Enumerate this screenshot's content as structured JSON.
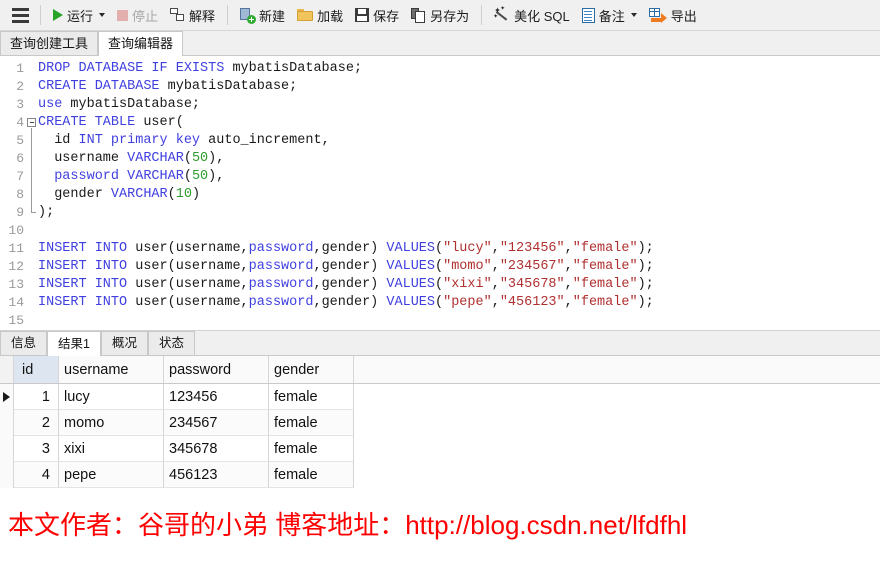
{
  "toolbar": {
    "menu_icon": "hamburger-icon",
    "items": [
      {
        "id": "run",
        "label": "运行",
        "icon": "play-triangle-icon",
        "has_caret": true,
        "disabled": false
      },
      {
        "id": "stop",
        "label": "停止",
        "icon": "stop-square-icon",
        "has_caret": false,
        "disabled": true
      },
      {
        "id": "explain",
        "label": "解释",
        "icon": "explain-icon",
        "has_caret": false,
        "disabled": false
      },
      {
        "id": "new",
        "label": "新建",
        "icon": "new-document-icon",
        "has_caret": false,
        "disabled": false
      },
      {
        "id": "load",
        "label": "加载",
        "icon": "folder-open-icon",
        "has_caret": false,
        "disabled": false
      },
      {
        "id": "save",
        "label": "保存",
        "icon": "floppy-save-icon",
        "has_caret": false,
        "disabled": false
      },
      {
        "id": "saveas",
        "label": "另存为",
        "icon": "save-as-icon",
        "has_caret": false,
        "disabled": false
      },
      {
        "id": "beautify",
        "label": "美化 SQL",
        "icon": "magic-wand-icon",
        "has_caret": false,
        "disabled": false
      },
      {
        "id": "comment",
        "label": "备注",
        "icon": "comment-doc-icon",
        "has_caret": true,
        "disabled": false
      },
      {
        "id": "export",
        "label": "导出",
        "icon": "export-arrow-icon",
        "has_caret": false,
        "disabled": false
      }
    ]
  },
  "editor_tabs": {
    "items": [
      {
        "label": "查询创建工具",
        "active": false
      },
      {
        "label": "查询编辑器",
        "active": true
      }
    ]
  },
  "editor": {
    "lines": [
      {
        "n": "1",
        "fold": "none",
        "tokens": [
          {
            "t": "DROP DATABASE IF EXISTS",
            "c": "kw"
          },
          {
            "t": " mybatisDatabase;",
            "c": ""
          }
        ]
      },
      {
        "n": "2",
        "fold": "none",
        "tokens": [
          {
            "t": "CREATE DATABASE",
            "c": "kw"
          },
          {
            "t": " mybatisDatabase;",
            "c": ""
          }
        ]
      },
      {
        "n": "3",
        "fold": "none",
        "tokens": [
          {
            "t": "use",
            "c": "kw"
          },
          {
            "t": " mybatisDatabase;",
            "c": ""
          }
        ]
      },
      {
        "n": "4",
        "fold": "start",
        "tokens": [
          {
            "t": "CREATE TABLE",
            "c": "kw"
          },
          {
            "t": " ",
            "c": ""
          },
          {
            "t": "user",
            "c": ""
          },
          {
            "t": "(",
            "c": ""
          }
        ]
      },
      {
        "n": "5",
        "fold": "line",
        "tokens": [
          {
            "t": "  id ",
            "c": ""
          },
          {
            "t": "INT primary key",
            "c": "kw"
          },
          {
            "t": " auto_increment,",
            "c": ""
          }
        ]
      },
      {
        "n": "6",
        "fold": "line",
        "tokens": [
          {
            "t": "  username ",
            "c": ""
          },
          {
            "t": "VARCHAR",
            "c": "kw"
          },
          {
            "t": "(",
            "c": ""
          },
          {
            "t": "50",
            "c": "num"
          },
          {
            "t": "),",
            "c": ""
          }
        ]
      },
      {
        "n": "7",
        "fold": "line",
        "tokens": [
          {
            "t": "  ",
            "c": ""
          },
          {
            "t": "password VARCHAR",
            "c": "kw"
          },
          {
            "t": "(",
            "c": ""
          },
          {
            "t": "50",
            "c": "num"
          },
          {
            "t": "),",
            "c": ""
          }
        ]
      },
      {
        "n": "8",
        "fold": "line",
        "tokens": [
          {
            "t": "  gender ",
            "c": ""
          },
          {
            "t": "VARCHAR",
            "c": "kw"
          },
          {
            "t": "(",
            "c": ""
          },
          {
            "t": "10",
            "c": "num"
          },
          {
            "t": ")",
            "c": ""
          }
        ]
      },
      {
        "n": "9",
        "fold": "end",
        "tokens": [
          {
            "t": ");",
            "c": ""
          }
        ]
      },
      {
        "n": "10",
        "fold": "none",
        "tokens": [
          {
            "t": "",
            "c": ""
          }
        ]
      },
      {
        "n": "11",
        "fold": "none",
        "tokens": [
          {
            "t": "INSERT INTO",
            "c": "kw"
          },
          {
            "t": " user(username,",
            "c": ""
          },
          {
            "t": "password",
            "c": "kw"
          },
          {
            "t": ",gender) ",
            "c": ""
          },
          {
            "t": "VALUES",
            "c": "kw"
          },
          {
            "t": "(",
            "c": ""
          },
          {
            "t": "\"lucy\"",
            "c": "str"
          },
          {
            "t": ",",
            "c": ""
          },
          {
            "t": "\"123456\"",
            "c": "str"
          },
          {
            "t": ",",
            "c": ""
          },
          {
            "t": "\"female\"",
            "c": "str"
          },
          {
            "t": ");",
            "c": ""
          }
        ]
      },
      {
        "n": "12",
        "fold": "none",
        "tokens": [
          {
            "t": "INSERT INTO",
            "c": "kw"
          },
          {
            "t": " user(username,",
            "c": ""
          },
          {
            "t": "password",
            "c": "kw"
          },
          {
            "t": ",gender) ",
            "c": ""
          },
          {
            "t": "VALUES",
            "c": "kw"
          },
          {
            "t": "(",
            "c": ""
          },
          {
            "t": "\"momo\"",
            "c": "str"
          },
          {
            "t": ",",
            "c": ""
          },
          {
            "t": "\"234567\"",
            "c": "str"
          },
          {
            "t": ",",
            "c": ""
          },
          {
            "t": "\"female\"",
            "c": "str"
          },
          {
            "t": ");",
            "c": ""
          }
        ]
      },
      {
        "n": "13",
        "fold": "none",
        "tokens": [
          {
            "t": "INSERT INTO",
            "c": "kw"
          },
          {
            "t": " user(username,",
            "c": ""
          },
          {
            "t": "password",
            "c": "kw"
          },
          {
            "t": ",gender) ",
            "c": ""
          },
          {
            "t": "VALUES",
            "c": "kw"
          },
          {
            "t": "(",
            "c": ""
          },
          {
            "t": "\"xixi\"",
            "c": "str"
          },
          {
            "t": ",",
            "c": ""
          },
          {
            "t": "\"345678\"",
            "c": "str"
          },
          {
            "t": ",",
            "c": ""
          },
          {
            "t": "\"female\"",
            "c": "str"
          },
          {
            "t": ");",
            "c": ""
          }
        ]
      },
      {
        "n": "14",
        "fold": "none",
        "tokens": [
          {
            "t": "INSERT INTO",
            "c": "kw"
          },
          {
            "t": " user(username,",
            "c": ""
          },
          {
            "t": "password",
            "c": "kw"
          },
          {
            "t": ",gender) ",
            "c": ""
          },
          {
            "t": "VALUES",
            "c": "kw"
          },
          {
            "t": "(",
            "c": ""
          },
          {
            "t": "\"pepe\"",
            "c": "str"
          },
          {
            "t": ",",
            "c": ""
          },
          {
            "t": "\"456123\"",
            "c": "str"
          },
          {
            "t": ",",
            "c": ""
          },
          {
            "t": "\"female\"",
            "c": "str"
          },
          {
            "t": ");",
            "c": ""
          }
        ]
      },
      {
        "n": "15",
        "fold": "none",
        "tokens": [
          {
            "t": "",
            "c": ""
          }
        ]
      }
    ]
  },
  "result_tabs": {
    "items": [
      {
        "label": "信息",
        "active": false
      },
      {
        "label": "结果1",
        "active": true
      },
      {
        "label": "概况",
        "active": false
      },
      {
        "label": "状态",
        "active": false
      }
    ]
  },
  "result_grid": {
    "columns": [
      "id",
      "username",
      "password",
      "gender"
    ],
    "selected_column": "id",
    "current_row_index": 0,
    "rows": [
      {
        "id": "1",
        "username": "lucy",
        "password": "123456",
        "gender": "female"
      },
      {
        "id": "2",
        "username": "momo",
        "password": "234567",
        "gender": "female"
      },
      {
        "id": "3",
        "username": "xixi",
        "password": "345678",
        "gender": "female"
      },
      {
        "id": "4",
        "username": "pepe",
        "password": "456123",
        "gender": "female"
      }
    ]
  },
  "watermark": {
    "text": "本文作者：谷哥的小弟 博客地址：http://blog.csdn.net/lfdfhl",
    "color": "#ff0000"
  },
  "colors": {
    "keyword": "#4040e0",
    "number": "#2f9c2f",
    "string": "#b03030",
    "toolbar_bg": "#f0f0f0",
    "selected_column_bg": "#dde6f0"
  }
}
